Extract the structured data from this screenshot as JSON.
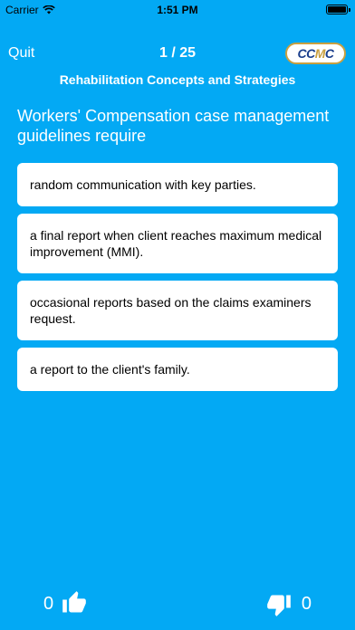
{
  "status": {
    "carrier": "Carrier",
    "time": "1:51 PM"
  },
  "nav": {
    "quit_label": "Quit",
    "progress": "1 / 25"
  },
  "logo": {
    "text_c1": "CC",
    "text_m": "M",
    "text_c2": "C",
    "colors": {
      "primary": "#1a3e8c",
      "accent": "#c9a040"
    }
  },
  "quiz": {
    "category": "Rehabilitation Concepts and Strategies",
    "question": "Workers' Compensation case management guidelines require",
    "answers": [
      "random communication with key parties.",
      "a final report when client reaches maximum medical improvement (MMI).",
      "occasional reports based on the claims examiners request.",
      "a report to the client's family."
    ]
  },
  "footer": {
    "likes": "0",
    "dislikes": "0"
  },
  "theme": {
    "background": "#03A9F4"
  }
}
